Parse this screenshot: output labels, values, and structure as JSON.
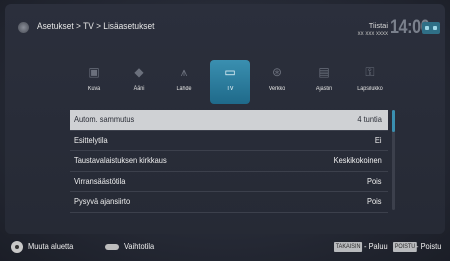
{
  "header": {
    "breadcrumb": "Asetukset > TV > Lisäasetukset",
    "day": "Tiistai",
    "date": "xx xxx xxxx",
    "time": "14:00"
  },
  "tabs": [
    {
      "label": "Kuva",
      "icon": "picture-icon"
    },
    {
      "label": "Ääni",
      "icon": "speaker-icon"
    },
    {
      "label": "Lähde",
      "icon": "antenna-icon"
    },
    {
      "label": "TV",
      "icon": "tv-icon",
      "active": true
    },
    {
      "label": "Verkko",
      "icon": "network-icon"
    },
    {
      "label": "Ajastin",
      "icon": "timer-icon"
    },
    {
      "label": "Lapsilukko",
      "icon": "lock-icon"
    }
  ],
  "settings": [
    {
      "name": "Autom. sammutus",
      "value": "4 tuntia",
      "selected": true
    },
    {
      "name": "Esittelytila",
      "value": "Ei"
    },
    {
      "name": "Taustavalaistuksen kirkkaus",
      "value": "Keskikokoinen"
    },
    {
      "name": "Virransäästötila",
      "value": "Pois"
    },
    {
      "name": "Pysyvä ajansiirto",
      "value": "Pois"
    }
  ],
  "footer": {
    "change_area": "Muuta aluetta",
    "change_mode": "Vaihtotila",
    "back_key": "TAKAISIN",
    "back_label": "- Paluu",
    "exit_key": "POISTU",
    "exit_label": "- Poistu"
  },
  "colors": {
    "accent": "#2f86a8",
    "selected_row": "#cfd1d4",
    "background": "#262a35"
  }
}
